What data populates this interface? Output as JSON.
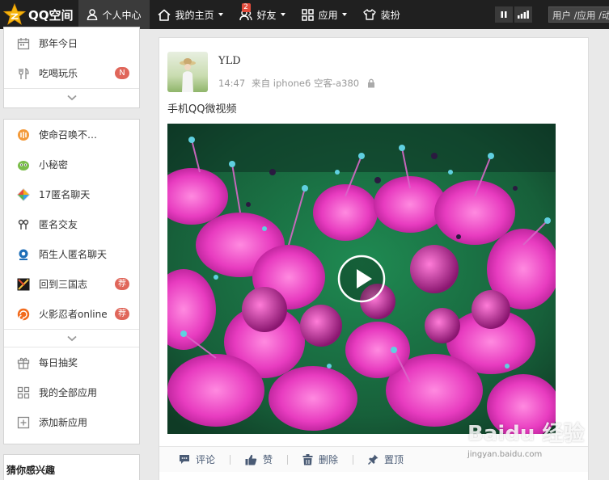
{
  "topbar": {
    "logo_text": "QQ空间",
    "nav": [
      {
        "label": "个人中心",
        "icon": "user-icon"
      },
      {
        "label": "我的主页",
        "icon": "home-icon"
      },
      {
        "label": "好友",
        "icon": "friends-icon",
        "badge": "2"
      },
      {
        "label": "应用",
        "icon": "apps-icon"
      },
      {
        "label": "装扮",
        "icon": "tshirt-icon"
      }
    ],
    "search_placeholder": "用户 /应用 /动"
  },
  "sidebar": {
    "top_items": [
      {
        "label": "那年今日",
        "icon": "calendar-icon"
      },
      {
        "label": "吃喝玩乐",
        "icon": "food-icon",
        "pill": "N"
      }
    ],
    "app_items": [
      {
        "label": "使命召唤不…",
        "icon": "call-of-duty-icon"
      },
      {
        "label": "小秘密",
        "icon": "secret-icon"
      },
      {
        "label": "17匿名聊天",
        "icon": "anon-chat-icon"
      },
      {
        "label": "匿名交友",
        "icon": "anon-friend-icon"
      },
      {
        "label": "陌生人匿名聊天",
        "icon": "stranger-chat-icon"
      },
      {
        "label": "回到三国志",
        "icon": "three-kingdoms-icon",
        "pill": "荐"
      },
      {
        "label": "火影忍者online",
        "icon": "naruto-icon",
        "pill": "荐"
      }
    ],
    "bottom_items": [
      {
        "label": "每日抽奖",
        "icon": "gift-icon"
      },
      {
        "label": "我的全部应用",
        "icon": "grid-icon"
      },
      {
        "label": "添加新应用",
        "icon": "plus-box-icon"
      }
    ],
    "interest_title": "猜你感兴趣"
  },
  "post": {
    "author": "YLD",
    "time": "14:47",
    "source": "来自 iphone6 空客-a380",
    "text": "手机QQ微视频",
    "actions": [
      {
        "label": "评论",
        "icon": "comment-icon"
      },
      {
        "label": "赞",
        "icon": "thumbs-up-icon"
      },
      {
        "label": "删除",
        "icon": "trash-icon"
      },
      {
        "label": "置顶",
        "icon": "pin-icon"
      }
    ]
  },
  "watermark": {
    "main": "Baidu 经验",
    "sub": "jingyan.baidu.com"
  },
  "colors": {
    "topbar": "#202020",
    "badge": "#e24b3b",
    "pill": "#e0665a",
    "link": "#4a5b75"
  }
}
